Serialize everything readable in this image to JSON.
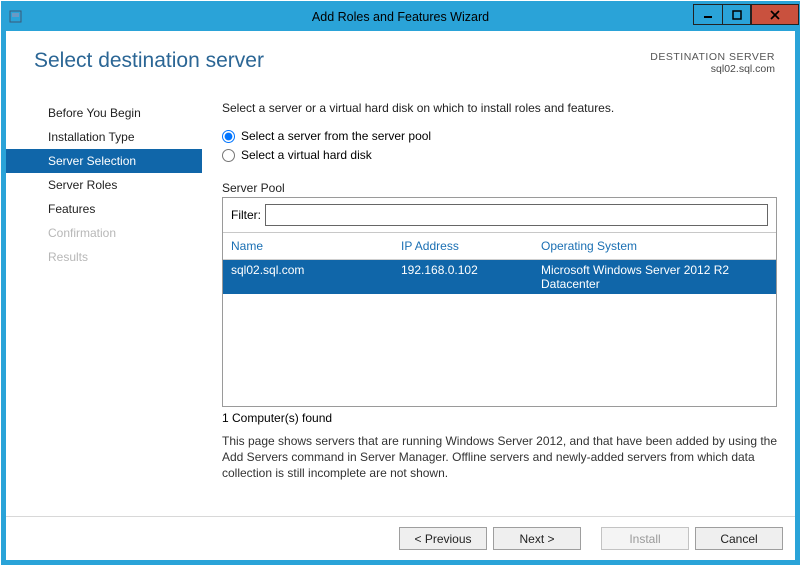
{
  "titlebar": {
    "title": "Add Roles and Features Wizard"
  },
  "header": {
    "page_title": "Select destination server",
    "dest_label": "DESTINATION SERVER",
    "dest_value": "sql02.sql.com"
  },
  "nav": {
    "items": [
      {
        "label": "Before You Begin",
        "state": "normal"
      },
      {
        "label": "Installation Type",
        "state": "normal"
      },
      {
        "label": "Server Selection",
        "state": "selected"
      },
      {
        "label": "Server Roles",
        "state": "normal"
      },
      {
        "label": "Features",
        "state": "normal"
      },
      {
        "label": "Confirmation",
        "state": "disabled"
      },
      {
        "label": "Results",
        "state": "disabled"
      }
    ]
  },
  "main": {
    "instruction": "Select a server or a virtual hard disk on which to install roles and features.",
    "radio_pool": "Select a server from the server pool",
    "radio_vhd": "Select a virtual hard disk",
    "section_label": "Server Pool",
    "filter_label": "Filter:",
    "filter_value": "",
    "columns": {
      "name": "Name",
      "ip": "IP Address",
      "os": "Operating System"
    },
    "rows": [
      {
        "name": "sql02.sql.com",
        "ip": "192.168.0.102",
        "os": "Microsoft Windows Server 2012 R2 Datacenter"
      }
    ],
    "found_text": "1 Computer(s) found",
    "note": "This page shows servers that are running Windows Server 2012, and that have been added by using the Add Servers command in Server Manager. Offline servers and newly-added servers from which data collection is still incomplete are not shown."
  },
  "footer": {
    "previous": "< Previous",
    "next": "Next >",
    "install": "Install",
    "cancel": "Cancel"
  }
}
